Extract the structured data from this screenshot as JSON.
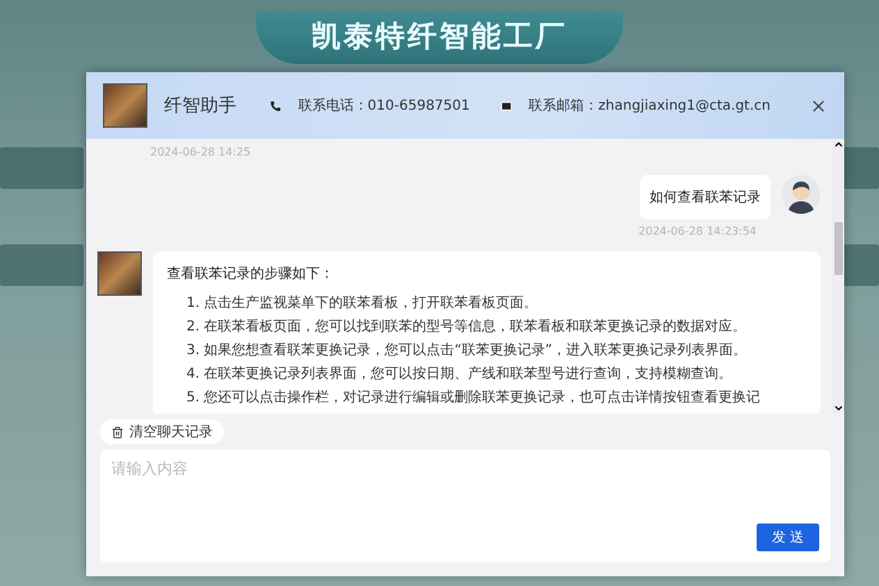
{
  "page": {
    "title": "凯泰特纤智能工厂"
  },
  "dialog": {
    "title": "纤智助手",
    "phone": {
      "label": "联系电话：",
      "value": "010-65987501"
    },
    "email": {
      "label": "联系邮箱：",
      "value": "zhangjiaxing1@cta.gt.cn"
    }
  },
  "messages": [
    {
      "kind": "bot",
      "time": "2024-06-28 14:25"
    },
    {
      "kind": "user",
      "text": "如何查看联苯记录",
      "time": "2024-06-28 14:23:54"
    },
    {
      "kind": "bot",
      "intro": "查看联苯记录的步骤如下：",
      "steps": [
        "1. 点击生产监视菜单下的联苯看板，打开联苯看板页面。",
        "2. 在联苯看板页面，您可以找到联苯的型号等信息，联苯看板和联苯更换记录的数据对应。",
        "3. 如果您想查看联苯更换记录，您可以点击“联苯更换记录”，进入联苯更换记录列表界面。",
        "4. 在联苯更换记录列表界面，您可以按日期、产线和联苯型号进行查询，支持模糊查询。",
        "5. 您还可以点击操作栏，对记录进行编辑或删除联苯更换记录，也可点击详情按钮查看更换记"
      ]
    }
  ],
  "clear_button": "清空聊天记录",
  "input": {
    "placeholder": "请输入内容"
  },
  "send_button": "发 送"
}
